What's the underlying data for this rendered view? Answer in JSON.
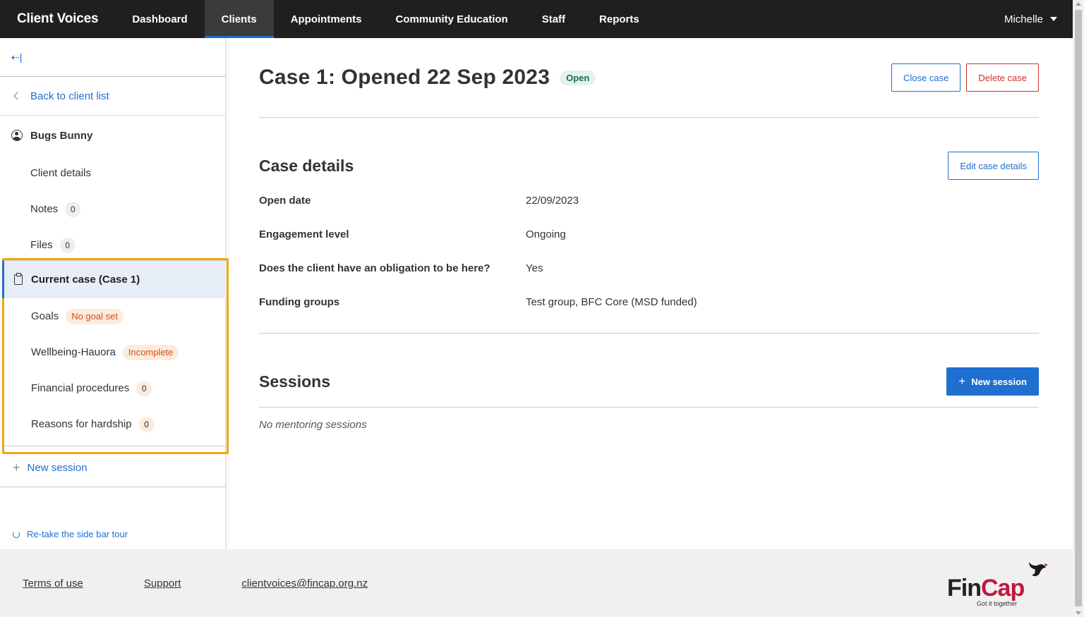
{
  "app": {
    "brand": "Client Voices"
  },
  "nav": {
    "items": [
      "Dashboard",
      "Clients",
      "Appointments",
      "Community Education",
      "Staff",
      "Reports"
    ],
    "active": "Clients",
    "user": "Michelle"
  },
  "sidebar": {
    "collapse_glyph": "⇠|",
    "back_label": "Back to client list",
    "client_name": "Bugs Bunny",
    "client_items": [
      {
        "label": "Client details",
        "count": null
      },
      {
        "label": "Notes",
        "count": "0"
      },
      {
        "label": "Files",
        "count": "0"
      }
    ],
    "current_case": "Current case (Case 1)",
    "case_items": [
      {
        "label": "Goals",
        "tag": "No goal set"
      },
      {
        "label": "Wellbeing-Hauora",
        "tag": "Incomplete"
      },
      {
        "label": "Financial procedures",
        "count": "0"
      },
      {
        "label": "Reasons for hardship",
        "count": "0"
      }
    ],
    "new_session": "New session",
    "retake_tour": "Re-take the side bar tour"
  },
  "main": {
    "case_title": "Case 1: Opened 22 Sep 2023",
    "status": "Open",
    "close_case": "Close case",
    "delete_case": "Delete case",
    "case_details_title": "Case details",
    "edit_case_details": "Edit case details",
    "details": [
      {
        "label": "Open date",
        "value": "22/09/2023"
      },
      {
        "label": "Engagement level",
        "value": "Ongoing"
      },
      {
        "label": "Does the client have an obligation to be here?",
        "value": "Yes"
      },
      {
        "label": "Funding groups",
        "value": "Test group, BFC Core (MSD funded)"
      }
    ],
    "sessions_title": "Sessions",
    "new_session": "New session",
    "no_sessions": "No mentoring sessions"
  },
  "footer": {
    "terms": "Terms of use",
    "support": "Support",
    "email": "clientvoices@fincap.org.nz",
    "logo_fin": "Fin",
    "logo_cap": "Cap",
    "logo_tagline": "Got it together"
  },
  "colors": {
    "accent": "#1f6fd0",
    "danger": "#d0312d",
    "highlight": "#f0a80c",
    "nav_bg": "#1f1f1f"
  }
}
